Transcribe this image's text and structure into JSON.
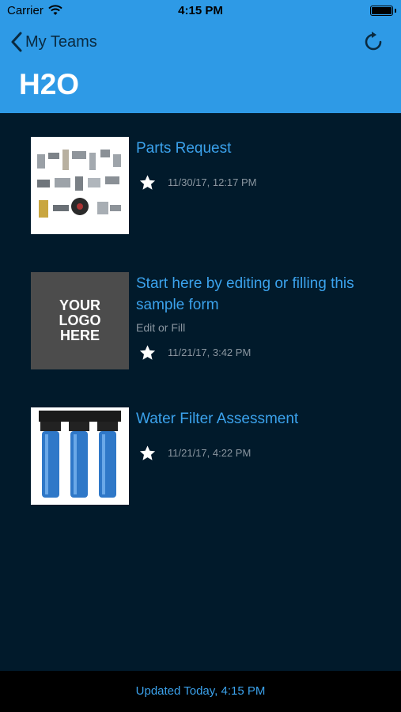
{
  "status_bar": {
    "carrier": "Carrier",
    "time": "4:15 PM",
    "wifi_icon": "wifi-icon",
    "battery_icon": "battery-icon"
  },
  "nav": {
    "back_label": "My Teams",
    "back_icon": "chevron-left-icon",
    "refresh_icon": "refresh-icon",
    "title": "H2O"
  },
  "forms": [
    {
      "title": "Parts Request",
      "subtitle": "",
      "date": "11/30/17, 12:17 PM",
      "favorite": true,
      "thumbnail": "parts-photo"
    },
    {
      "title": "Start here by editing or filling this sample form",
      "subtitle": "Edit or Fill",
      "date": "11/21/17, 3:42 PM",
      "favorite": true,
      "thumbnail": "logo-placeholder",
      "thumbnail_text": "YOUR LOGO HERE"
    },
    {
      "title": "Water Filter Assessment",
      "subtitle": "",
      "date": "11/21/17, 4:22 PM",
      "favorite": true,
      "thumbnail": "water-filter-photo"
    }
  ],
  "footer": {
    "updated": "Updated Today, 4:15 PM"
  },
  "colors": {
    "header": "#2e9ae6",
    "background": "#011a2b",
    "accent": "#3ba2ec",
    "footer": "#000000"
  }
}
